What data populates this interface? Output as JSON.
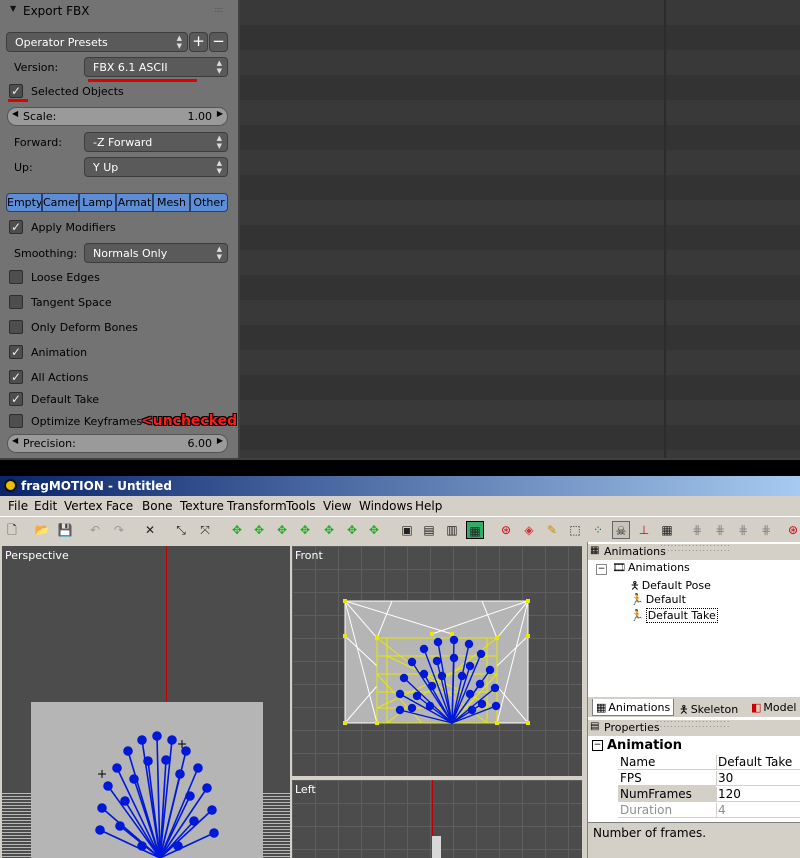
{
  "blender": {
    "panel_title": "Export FBX",
    "operator_presets": "Operator Presets",
    "version_label": "Version:",
    "version_value": "FBX 6.1 ASCII",
    "selected_objects": "Selected Objects",
    "scale_label": "Scale:",
    "scale_value": "1.00",
    "forward_label": "Forward:",
    "forward_value": "-Z Forward",
    "up_label": "Up:",
    "up_value": "Y Up",
    "type_buttons": [
      "Empty",
      "Camer",
      "Lamp",
      "Armat",
      "Mesh",
      "Other"
    ],
    "apply_modifiers": "Apply Modifiers",
    "smoothing_label": "Smoothing:",
    "smoothing_value": "Normals Only",
    "checkboxes": [
      {
        "label": "Loose Edges",
        "checked": false
      },
      {
        "label": "Tangent Space",
        "checked": false
      },
      {
        "label": "Only Deform Bones",
        "checked": false
      },
      {
        "label": "Animation",
        "checked": true
      },
      {
        "label": "All Actions",
        "checked": true
      },
      {
        "label": "Default Take",
        "checked": true
      },
      {
        "label": "Optimize Keyframes",
        "checked": false
      }
    ],
    "annotation": "<unchecked",
    "precision_label": "Precision:",
    "precision_value": "6.00"
  },
  "frag": {
    "title": "fragMOTION - Untitled",
    "menu": [
      "File",
      "Edit",
      "Vertex",
      "Face",
      "Bone",
      "Texture",
      "Transform",
      "Tools",
      "View",
      "Windows",
      "Help"
    ],
    "viewports": {
      "perspective": "Perspective",
      "front": "Front",
      "left": "Left"
    },
    "animations_panel_title": "Animations",
    "tree": {
      "root": "Animations",
      "items": [
        "Default Pose",
        "Default",
        "Default Take"
      ]
    },
    "tabs": [
      "Animations",
      "Skeleton",
      "Model"
    ],
    "properties_title": "Properties",
    "properties_section": "Animation",
    "properties": [
      {
        "name": "Name",
        "value": "Default Take"
      },
      {
        "name": "FPS",
        "value": "30"
      },
      {
        "name": "NumFrames",
        "value": "120"
      },
      {
        "name": "Duration",
        "value": "4"
      }
    ],
    "status_text": "Number of frames."
  },
  "colors": {
    "blender_panel": "#737373",
    "blender_button_blue": "#5d8dd6",
    "annotation_red": "#ff1a1a",
    "fm_titlebar": "#0a246a",
    "viewport_bg": "#4c4c4c",
    "mesh_blue": "#0018d8",
    "mesh_yellow": "#ffff00"
  }
}
